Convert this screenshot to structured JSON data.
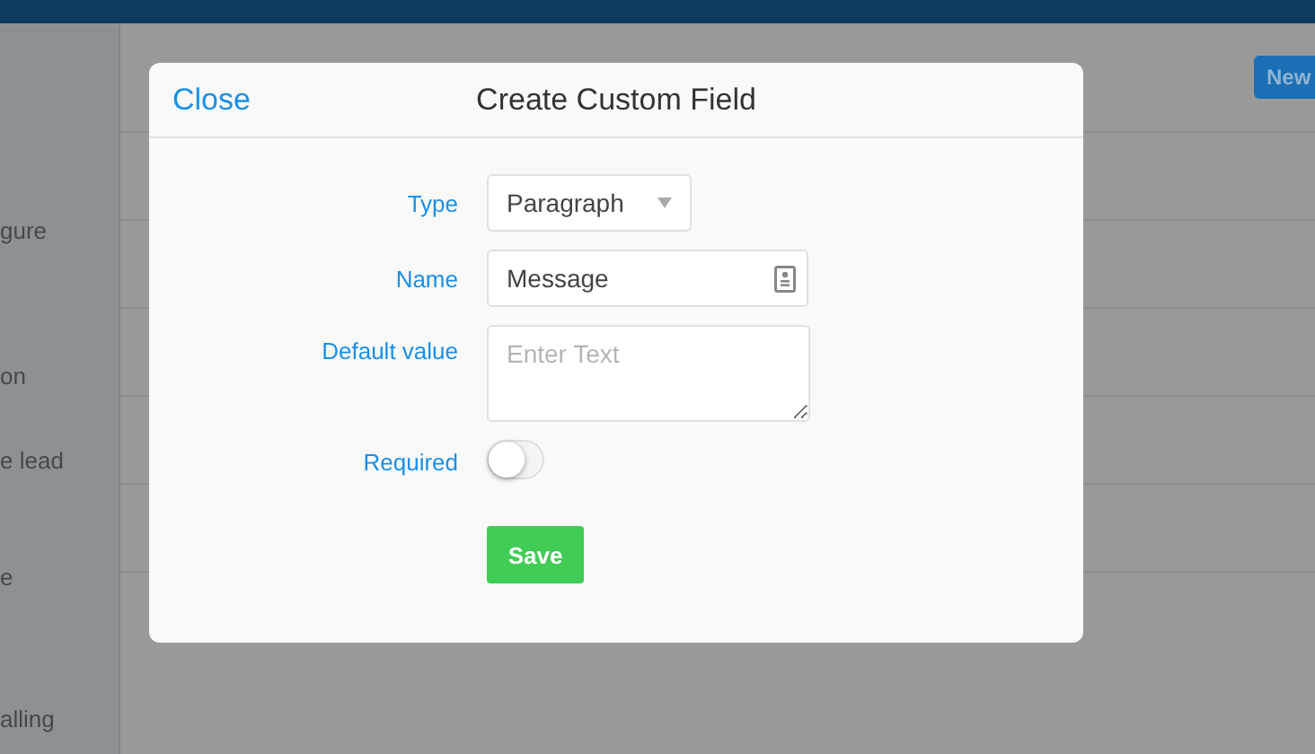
{
  "sidebar": {
    "items": [
      {
        "label": "gure"
      },
      {
        "label": "on"
      },
      {
        "label": "e lead"
      },
      {
        "label": "e"
      },
      {
        "label": "alling"
      }
    ]
  },
  "toolbar": {
    "new_button": "New"
  },
  "dialog": {
    "close": "Close",
    "title": "Create Custom Field",
    "fields": [
      {
        "kind": "select",
        "label": "Type",
        "value": "Paragraph"
      },
      {
        "kind": "text",
        "label": "Name",
        "value": "Message"
      },
      {
        "kind": "textarea",
        "label": "Default value",
        "placeholder": "Enter Text"
      },
      {
        "kind": "toggle",
        "label": "Required",
        "on": false
      }
    ],
    "save": "Save"
  }
}
